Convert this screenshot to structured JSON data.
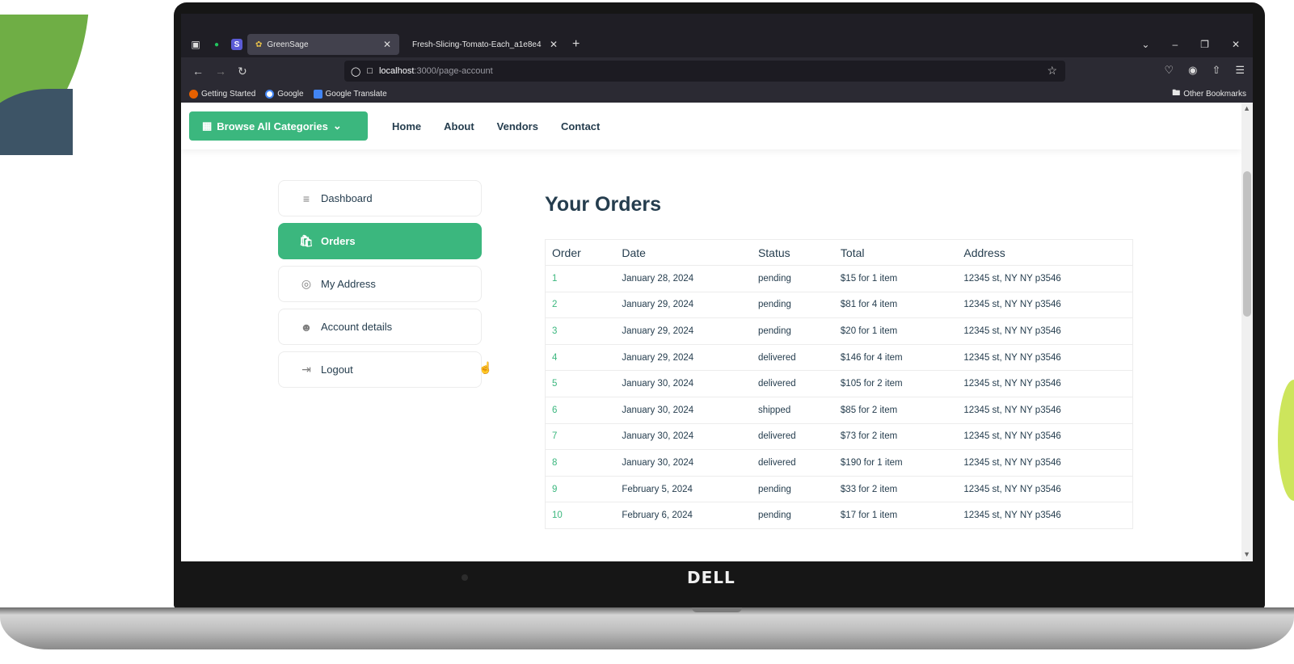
{
  "browser": {
    "tabs": [
      {
        "title": "GreenSage",
        "active": true
      },
      {
        "title": "Fresh-Slicing-Tomato-Each_a1e8e4",
        "active": false
      }
    ],
    "url_host": "localhost",
    "url_path": ":3000/page-account",
    "bookmarks": [
      "Getting Started",
      "Google",
      "Google Translate"
    ],
    "other_bookmarks": "Other Bookmarks"
  },
  "header": {
    "browse_label": "Browse All Categories",
    "menu": [
      "Home",
      "About",
      "Vendors",
      "Contact"
    ]
  },
  "sidebar": {
    "items": [
      {
        "label": "Dashboard",
        "icon": "sliders-icon",
        "active": false
      },
      {
        "label": "Orders",
        "icon": "bag-icon",
        "active": true
      },
      {
        "label": "My Address",
        "icon": "location-pin-icon",
        "active": false
      },
      {
        "label": "Account details",
        "icon": "user-icon",
        "active": false
      },
      {
        "label": "Logout",
        "icon": "logout-icon",
        "active": false
      }
    ]
  },
  "main": {
    "title": "Your Orders",
    "columns": [
      "Order",
      "Date",
      "Status",
      "Total",
      "Address"
    ],
    "rows": [
      [
        "1",
        "January 28, 2024",
        "pending",
        "$15 for 1 item",
        "12345 st, NY NY p3546"
      ],
      [
        "2",
        "January 29, 2024",
        "pending",
        "$81 for 4 item",
        "12345 st, NY NY p3546"
      ],
      [
        "3",
        "January 29, 2024",
        "pending",
        "$20 for 1 item",
        "12345 st, NY NY p3546"
      ],
      [
        "4",
        "January 29, 2024",
        "delivered",
        "$146 for 4 item",
        "12345 st, NY NY p3546"
      ],
      [
        "5",
        "January 30, 2024",
        "delivered",
        "$105 for 2 item",
        "12345 st, NY NY p3546"
      ],
      [
        "6",
        "January 30, 2024",
        "shipped",
        "$85 for 2 item",
        "12345 st, NY NY p3546"
      ],
      [
        "7",
        "January 30, 2024",
        "delivered",
        "$73 for 2 item",
        "12345 st, NY NY p3546"
      ],
      [
        "8",
        "January 30, 2024",
        "delivered",
        "$190 for 1 item",
        "12345 st, NY NY p3546"
      ],
      [
        "9",
        "February 5, 2024",
        "pending",
        "$33 for 2 item",
        "12345 st, NY NY p3546"
      ],
      [
        "10",
        "February 6, 2024",
        "pending",
        "$17 for 1 item",
        "12345 st, NY NY p3546"
      ]
    ]
  },
  "device": {
    "brand": "DELL"
  },
  "colors": {
    "accent": "#3bb77e",
    "heading": "#253d4e"
  }
}
